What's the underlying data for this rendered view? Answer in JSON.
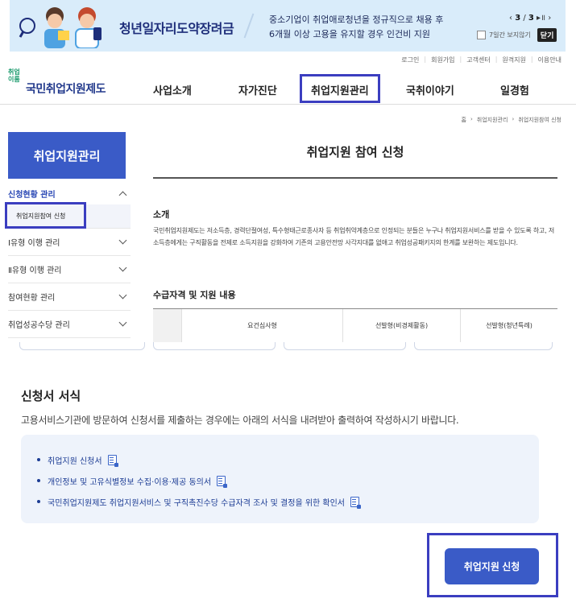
{
  "banner": {
    "title": "청년일자리도약장려금",
    "desc_line1": "중소기업이 취업애로청년을 정규직으로 채용 후",
    "desc_line2": "6개월 이상 고용을 유지할 경우 인건비 지원",
    "page_current": "3",
    "page_total": "3",
    "hide_week_label": "7일간 보지않기",
    "close_label": "닫기"
  },
  "util_links": [
    "로그인",
    "회원가입",
    "고객센터",
    "원격지원",
    "이용안내"
  ],
  "logo": {
    "mini": "취업이룸",
    "name": "국민취업지원제도"
  },
  "nav": [
    "사업소개",
    "자가진단",
    "취업지원관리",
    "국취이야기",
    "일경험"
  ],
  "breadcrumb": [
    "홈",
    "취업지원관리",
    "취업지원참여 신청"
  ],
  "sidebar": {
    "title": "취업지원관리",
    "active_group": "신청현황 관리",
    "active_sub": "취업지원참여 신청",
    "items": [
      "Ⅰ유형 이행 관리",
      "Ⅱ유형 이행 관리",
      "참여현황 관리",
      "취업성공수당 관리"
    ]
  },
  "main": {
    "title": "취업지원 참여 신청",
    "intro_heading": "소개",
    "intro_text": "국민취업지원제도는 저소득층, 경력단절여성, 특수형태근로종사자 등 취업취약계층으로 인정되는 분들은 누구나 취업지원서비스를 받을 수 있도록 하고, 저소득층에게는 구직활동을 전제로 소득지원을 강화하여 기존의 고용안전망 사각지대를 없애고 취업성공패키지의 한계를 보완하는 제도입니다.",
    "qual_heading": "수급자격 및 지원 내용",
    "table_headers": [
      "요건심사형",
      "선발형(비경제활동)",
      "선발형(청년특례)"
    ]
  },
  "forms": {
    "title": "신청서 서식",
    "desc": "고용서비스기관에 방문하여 신청서를 제출하는 경우에는 아래의 서식을 내려받아 출력하여 작성하시기 바랍니다.",
    "items": [
      "취업지원 신청서",
      "개인정보 및 고유식별정보 수집·이용·제공 동의서",
      "국민취업지원제도 취업지원서비스 및 구직촉진수당 수급자격 조사 및 결정을 위한 확인서"
    ]
  },
  "apply_button": "취업지원 신청",
  "colors": {
    "primary": "#3a5bc7",
    "highlight": "#3b3ec0",
    "banner_bg": "#d9ecfa"
  }
}
